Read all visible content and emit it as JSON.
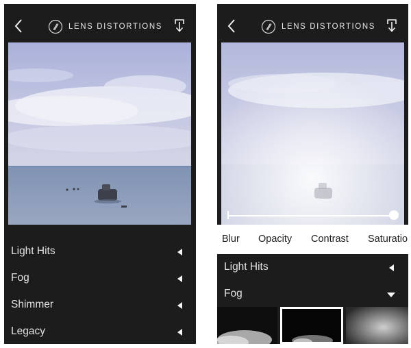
{
  "app": {
    "brand": "LENS DISTORTIONS"
  },
  "icons": {
    "back": "chevron-left-icon",
    "download": "download-icon",
    "logo": "lens-distortions-logo",
    "collapsed": "triangle-left-icon",
    "expanded": "triangle-down-icon"
  },
  "left_screen": {
    "menu": [
      {
        "label": "Light Hits",
        "state": "collapsed"
      },
      {
        "label": "Fog",
        "state": "collapsed"
      },
      {
        "label": "Shimmer",
        "state": "collapsed"
      },
      {
        "label": "Legacy",
        "state": "collapsed"
      }
    ]
  },
  "right_screen": {
    "slider": {
      "label": "Blur",
      "value": 1.0
    },
    "tabs": [
      "Blur",
      "Opacity",
      "Contrast",
      "Saturatio"
    ],
    "active_tab": "Blur",
    "menu": [
      {
        "label": "Light Hits",
        "state": "collapsed"
      },
      {
        "label": "Fog",
        "state": "expanded"
      }
    ],
    "fog_thumbnails": {
      "count_visible": 3,
      "selected_index": 1
    }
  },
  "colors": {
    "panel": "#1c1c1c",
    "text": "#e2e2e2",
    "tab_bar": "#ffffff",
    "tab_text": "#1e1e1e"
  }
}
